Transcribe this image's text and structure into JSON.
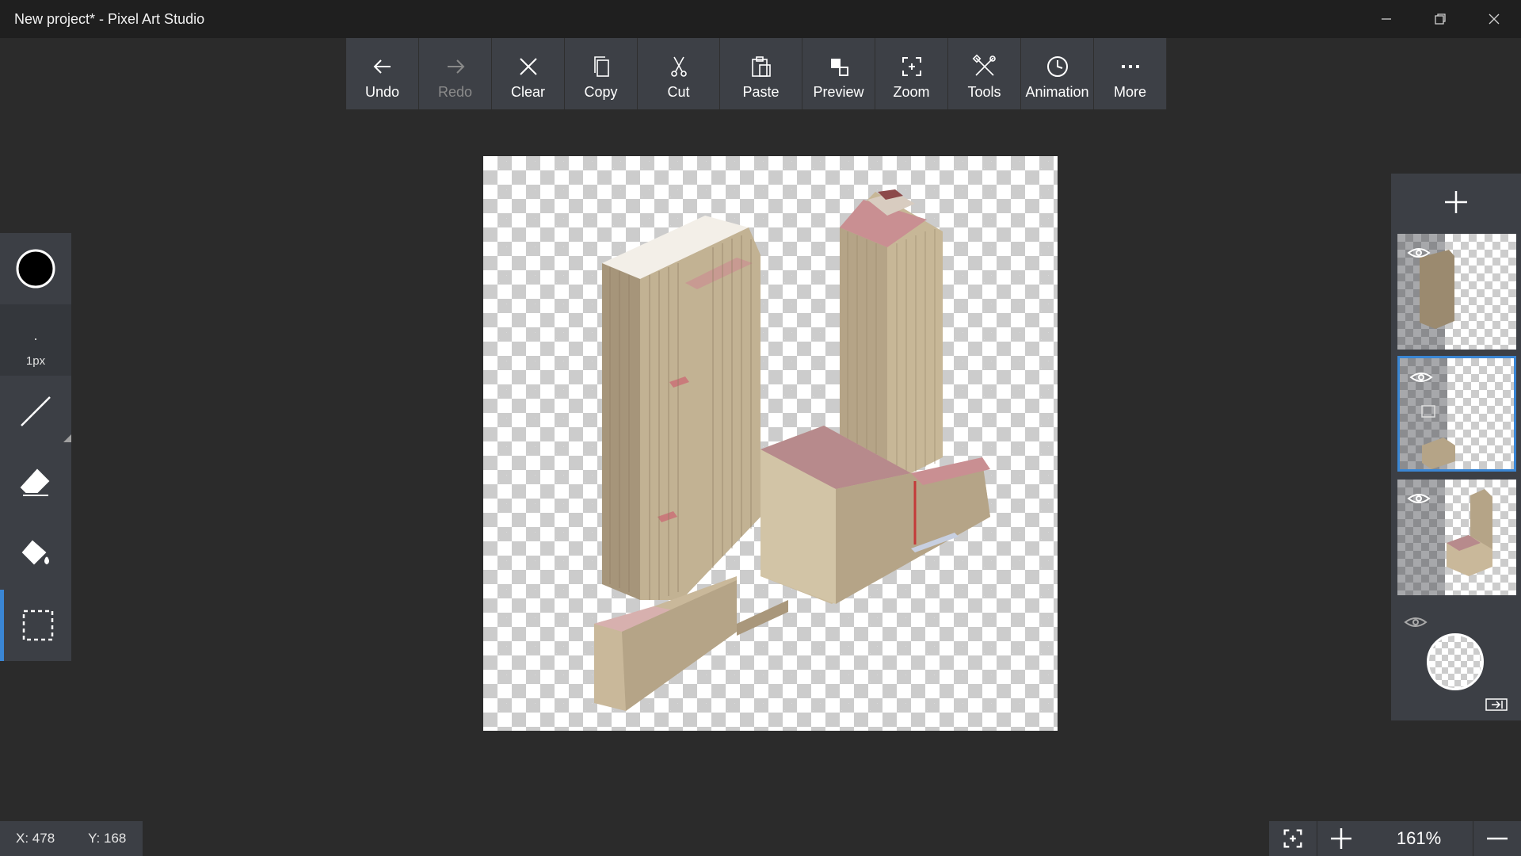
{
  "window": {
    "title": "New project* - Pixel Art Studio"
  },
  "toolbar": {
    "items": [
      {
        "label": "Undo",
        "icon": "arrow-left-icon"
      },
      {
        "label": "Redo",
        "icon": "arrow-right-icon"
      },
      {
        "label": "Clear",
        "icon": "close-icon"
      },
      {
        "label": "Copy",
        "icon": "copy-icon"
      },
      {
        "label": "Cut",
        "icon": "scissors-icon"
      },
      {
        "label": "Paste",
        "icon": "paste-icon"
      },
      {
        "label": "Preview",
        "icon": "preview-icon"
      },
      {
        "label": "Zoom",
        "icon": "zoom-fit-icon"
      },
      {
        "label": "Tools",
        "icon": "tools-icon"
      },
      {
        "label": "Animation",
        "icon": "clock-icon"
      },
      {
        "label": "More",
        "icon": "more-icon"
      }
    ]
  },
  "left_panel": {
    "brush_size": "1px",
    "primary_color": "#000000"
  },
  "status": {
    "x": "X: 478",
    "y": "Y: 168",
    "zoom": "161%"
  },
  "colors": {
    "accent": "#3a86d4",
    "background": "#2b2b2b",
    "panel": "#3c3f45"
  }
}
